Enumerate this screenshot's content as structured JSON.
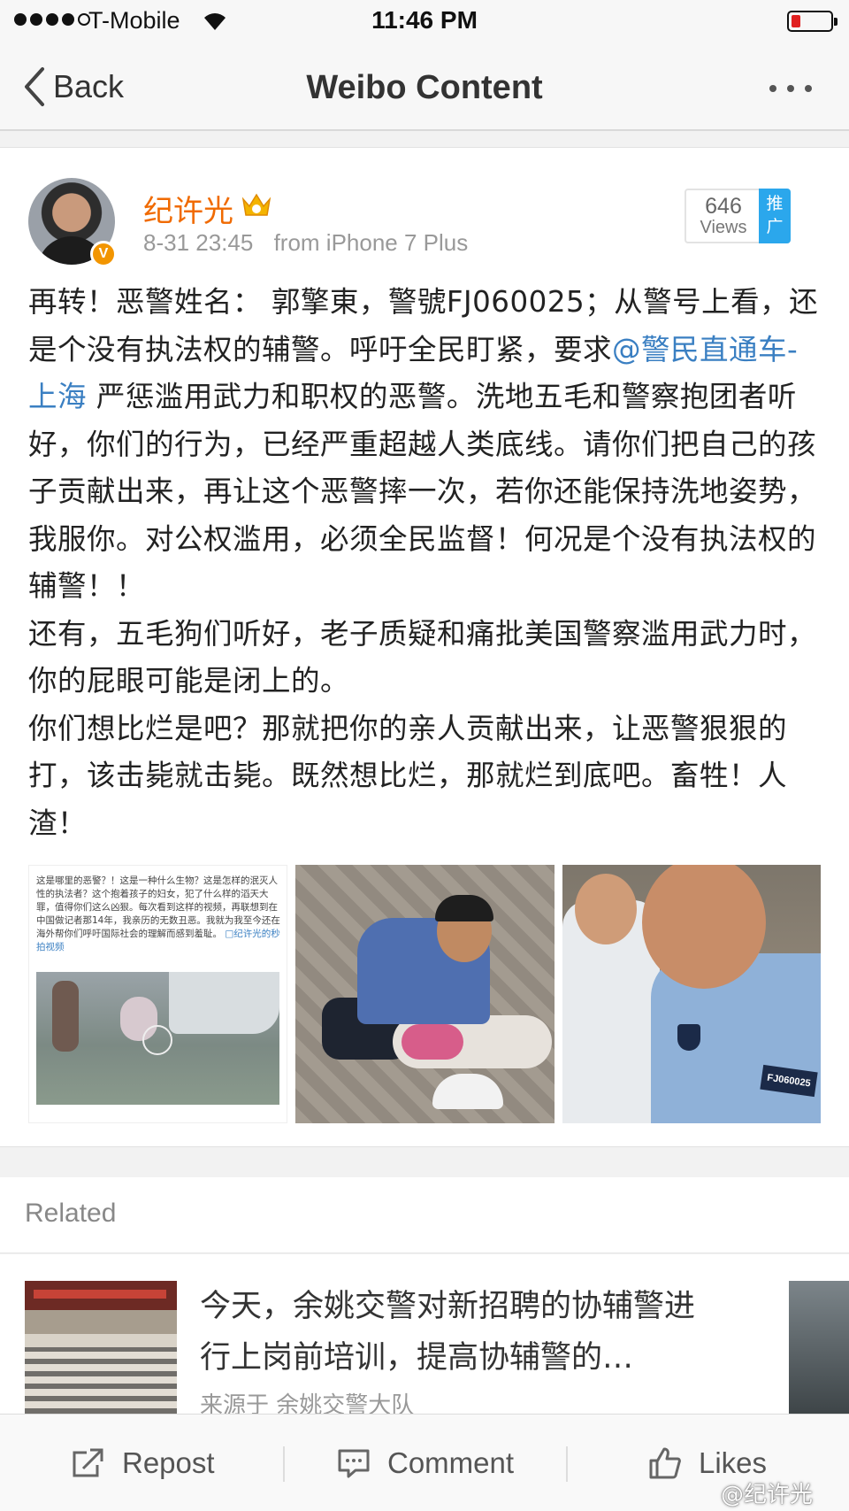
{
  "status_bar": {
    "carrier": "T-Mobile",
    "time": "11:46 PM",
    "signal_bars_filled": 4,
    "signal_bars_total": 5,
    "battery_level": "low",
    "battery_color": "#e02020"
  },
  "nav": {
    "back_label": "Back",
    "title": "Weibo Content",
    "more_icon": "ellipsis-icon"
  },
  "post": {
    "author": "纪许光",
    "timestamp": "8-31 23:45",
    "source": "from iPhone 7 Plus",
    "views_count": "646",
    "views_label": "Views",
    "promote_label": "推广",
    "text_part1": "再转！恶警姓名： 郭擎東，警號FJ060025；从警号上看，还是个没有执法权的辅警。呼吁全民盯紧，要求",
    "mention": "@警民直通车-上海",
    "text_part2": " 严惩滥用武力和职权的恶警。洗地五毛和警察抱团者听好，你们的行为，已经严重超越人类底线。请你们把自己的孩子贡献出来，再让这个恶警摔一次，若你还能保持洗地姿势，我服你。对公权滥用，必须全民监督！何况是个没有执法权的辅警！！",
    "text_part3": "还有，五毛狗们听好，老子质疑和痛批美国警察滥用武力时，你的屁眼可能是闭上的。",
    "text_part4": "你们想比烂是吧？那就把你的亲人贡献出来，让恶警狠狠的打，该击毙就击毙。既然想比烂，那就烂到底吧。畜牲！人渣！",
    "image1_caption": "这是哪里的恶警？！这是一种什么生物？这是怎样的泯灭人性的执法者？这个抱着孩子的妇女，犯了什么样的滔天大罪，值得你们这么凶狠。每次看到这样的视频，再联想到在中国做记者那14年，我亲历的无数丑恶。我就为我至今还在海外帮你们呼吁国际社会的理解而感到羞耻。",
    "image1_link": "□纪许光的秒拍视频",
    "image3_badge": "FJ060025"
  },
  "related": {
    "title": "Related",
    "item_text": "今天，余姚交警对新招聘的协辅警进行上岗前培训，提高协辅警的…",
    "item_source": "来源于 余姚交警大队"
  },
  "bottom_bar": {
    "repost_label": "Repost",
    "comment_label": "Comment",
    "likes_label": "Likes",
    "watermark": "@纪许光"
  }
}
